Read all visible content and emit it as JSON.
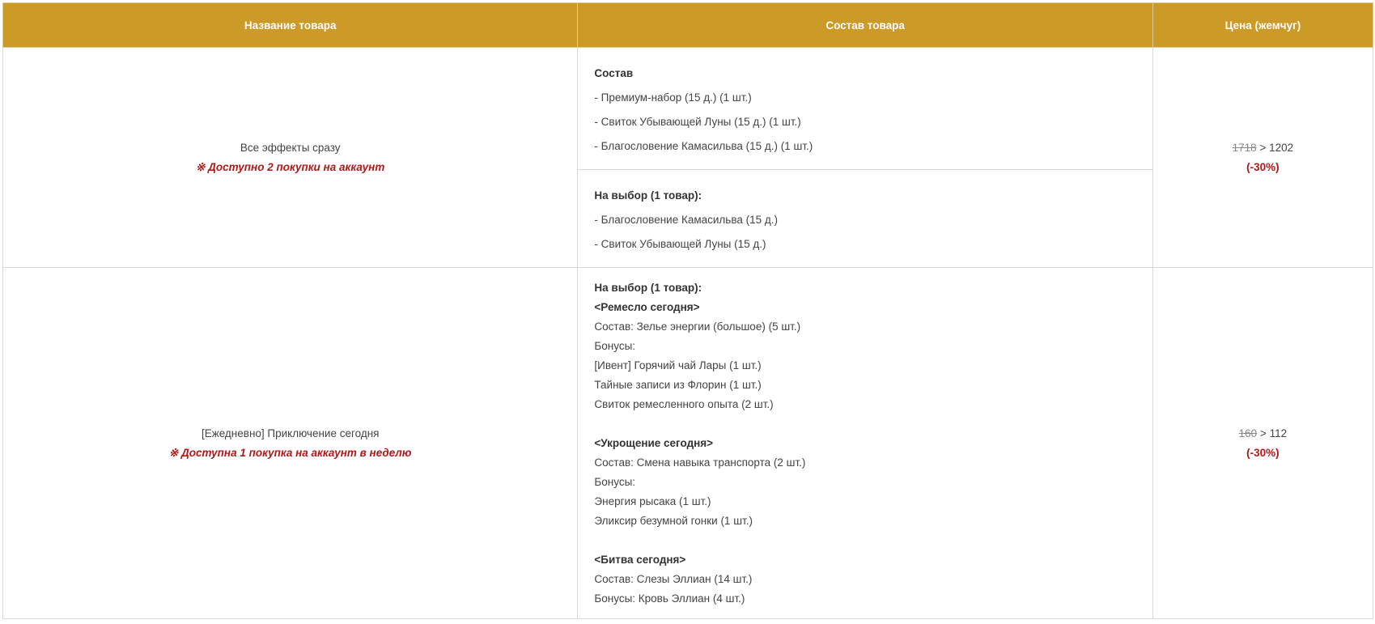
{
  "table": {
    "headers": {
      "name": "Название товара",
      "composition": "Состав товара",
      "price": "Цена (жемчуг)"
    },
    "rows": [
      {
        "name": "Все эффекты сразу",
        "limit": "※ Доступно 2 покупки на аккаунт",
        "composition": {
          "included_title": "Состав",
          "included_items": [
            "- Премиум-набор (15 д.) (1 шт.)",
            "- Свиток Убывающей Луны (15 д.) (1 шт.)",
            "- Благословение Камасильва (15 д.) (1 шт.)"
          ],
          "choice_title": "На выбор (1 товар):",
          "choice_items": [
            "- Благословение Камасильва (15 д.)",
            "- Свиток Убывающей Луны (15 д.)"
          ]
        },
        "price": {
          "old": "1718",
          "sep": ">",
          "new": "1202",
          "discount": "(-30%)"
        }
      },
      {
        "name": "[Ежедневно] Приключение сегодня",
        "limit": "※ Доступна 1 покупка на аккаунт в неделю",
        "composition": {
          "choice_title": "На выбор (1 товар):",
          "groups": [
            {
              "title": "<Ремесло сегодня>",
              "lines": [
                "Состав: Зелье энергии (большое) (5 шт.)",
                "Бонусы:",
                "[Ивент] Горячий чай Лары (1 шт.)",
                "Тайные записи из Флорин (1 шт.)",
                "Свиток ремесленного опыта (2 шт.)"
              ]
            },
            {
              "title": "<Укрощение сегодня>",
              "lines": [
                "Состав: Смена навыка транспорта (2 шт.)",
                "Бонусы:",
                "Энергия рысака (1 шт.)",
                "Эликсир безумной гонки (1 шт.)"
              ]
            },
            {
              "title": "<Битва сегодня>",
              "lines": [
                "Состав: Слезы Эллиан (14 шт.)",
                "Бонусы: Кровь Эллиан (4 шт.)"
              ]
            }
          ]
        },
        "price": {
          "old": "160",
          "sep": ">",
          "new": "112",
          "discount": "(-30%)"
        }
      }
    ]
  },
  "colors": {
    "header_bg": "#cc9a27",
    "header_text": "#ffffff",
    "limit_text": "#b21818",
    "border": "#d9d9d9"
  }
}
